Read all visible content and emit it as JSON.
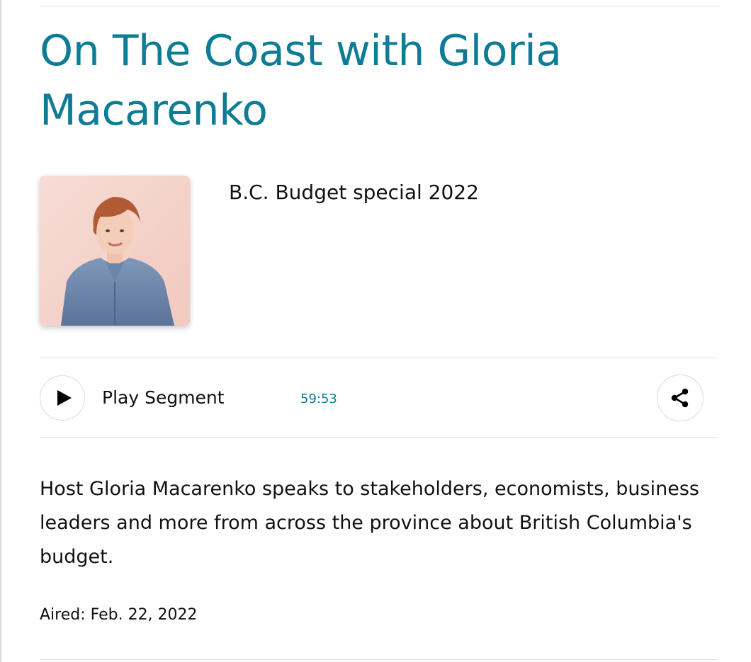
{
  "show": {
    "title": "On The Coast with Gloria Macarenko"
  },
  "episode": {
    "title": "B.C. Budget special 2022",
    "thumbnail_alt": "Gloria Macarenko"
  },
  "player": {
    "play_label": "Play Segment",
    "duration": "59:53",
    "play_icon": "play-icon",
    "share_icon": "share-icon"
  },
  "description": "Host Gloria Macarenko speaks to stakeholders, economists, business leaders and more from across the province about British Columbia's budget.",
  "aired": "Aired: Feb. 22, 2022",
  "colors": {
    "accent": "#0e7c95",
    "text": "#111111",
    "divider": "#e2e2e2"
  }
}
